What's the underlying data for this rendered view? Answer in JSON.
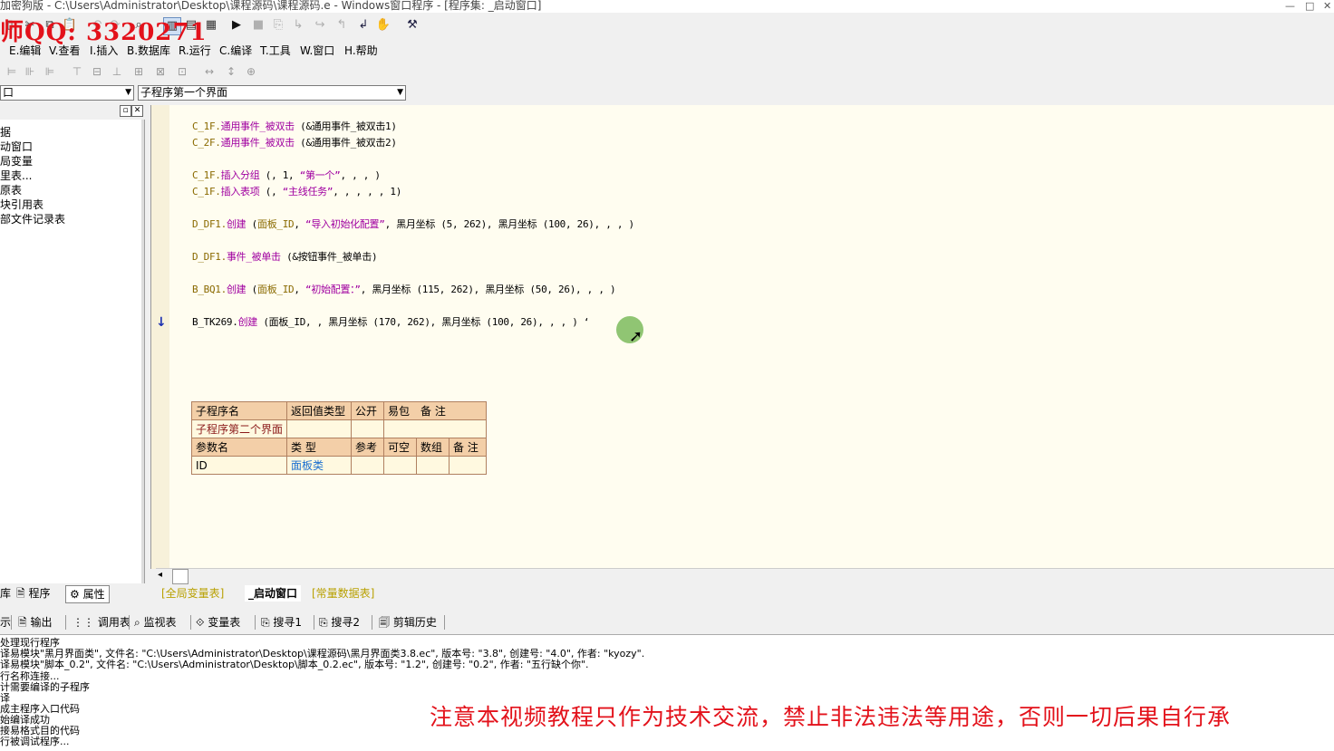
{
  "window": {
    "title": "加密狗版 - C:\\Users\\Administrator\\Desktop\\课程源码\\课程源码.e - Windows窗口程序 - [程序集: _启动窗口]"
  },
  "overlay": {
    "qq": "师QQ: 3320271",
    "warning": "注意本视频教程只作为技术交流，禁止非法违法等用途，否则一切后果自行承"
  },
  "menu": {
    "items": [
      "E.编辑",
      "V.查看",
      "I.插入",
      "B.数据库",
      "R.运行",
      "C.编译",
      "T.工具",
      "W.窗口",
      "H.帮助"
    ]
  },
  "combos": {
    "left_value": "口",
    "right_value": "子程序第一个界面"
  },
  "tree": {
    "items": [
      "据",
      "动窗口",
      "局变量",
      "里表...",
      "原表",
      "块引用表",
      "部文件记录表"
    ]
  },
  "left_tabs": [
    "库",
    "程序",
    "属性"
  ],
  "editor": {
    "lines": [
      [
        [
          "C_1F.",
          "obj"
        ],
        [
          "通用事件_被双击",
          "met"
        ],
        [
          " (&通用事件_被双击1)",
          "blk"
        ]
      ],
      [
        [
          "C_2F.",
          "obj"
        ],
        [
          "通用事件_被双击",
          "met"
        ],
        [
          " (&通用事件_被双击2)",
          "blk"
        ]
      ],
      [],
      [
        [
          "C_1F.",
          "obj"
        ],
        [
          "插入分组",
          "met"
        ],
        [
          " (, 1, ",
          "blk"
        ],
        [
          "“第一个”",
          "str"
        ],
        [
          ", , , )",
          "blk"
        ]
      ],
      [
        [
          "C_1F.",
          "obj"
        ],
        [
          "插入表项",
          "met"
        ],
        [
          " (, ",
          "blk"
        ],
        [
          "“主线任务”",
          "str"
        ],
        [
          ", , , , , 1)",
          "blk"
        ]
      ],
      [],
      [
        [
          "D_DF1.",
          "obj"
        ],
        [
          "创建",
          "met"
        ],
        [
          " (",
          "blk"
        ],
        [
          "面板_ID",
          "arg"
        ],
        [
          ", ",
          "blk"
        ],
        [
          "“导入初始化配置”",
          "str"
        ],
        [
          ", 黑月坐标 (5, 262), 黑月坐标 (100, 26), , , )",
          "blk"
        ]
      ],
      [],
      [
        [
          "D_DF1.",
          "obj"
        ],
        [
          "事件_被单击",
          "met"
        ],
        [
          " (&按钮事件_被单击)",
          "blk"
        ]
      ],
      [],
      [
        [
          "B_BQ1.",
          "obj"
        ],
        [
          "创建",
          "met"
        ],
        [
          " (",
          "blk"
        ],
        [
          "面板_ID",
          "arg"
        ],
        [
          ", ",
          "blk"
        ],
        [
          "“初始配置：”",
          "str"
        ],
        [
          ", 黑月坐标 (115, 262), 黑月坐标 (50, 26), , , )",
          "blk"
        ]
      ],
      [],
      [
        [
          "B_TK269.",
          "blk"
        ],
        [
          "创建",
          "met"
        ],
        [
          " (面板_ID, , 黑月坐标 (170, 262), 黑月坐标 (100, 26), , , ) ‘",
          "blk"
        ]
      ]
    ]
  },
  "subtable": {
    "header1": [
      "子程序名",
      "返回值类型",
      "公开",
      "易包",
      "备 注"
    ],
    "row1": [
      "子程序第二个界面",
      "",
      "",
      "",
      ""
    ],
    "header2": [
      "参数名",
      "类 型",
      "参考",
      "可空",
      "数组",
      "备 注"
    ],
    "row2": [
      "ID",
      "面板类",
      "",
      "",
      "",
      ""
    ]
  },
  "editor_tabs": [
    "[全局变量表]",
    "_启动窗口",
    "[常量数据表]"
  ],
  "output_tabs": [
    "示",
    "输出",
    "调用表",
    "监视表",
    "变量表",
    "搜寻1",
    "搜寻2",
    "剪辑历史"
  ],
  "output": {
    "lines": [
      "处理现行程序",
      "译易模块\"黑月界面类\", 文件名: \"C:\\Users\\Administrator\\Desktop\\课程源码\\黑月界面类3.8.ec\", 版本号: \"3.8\", 创建号: \"4.0\", 作者: \"kyozy\".",
      "译易模块\"脚本_0.2\", 文件名: \"C:\\Users\\Administrator\\Desktop\\脚本_0.2.ec\", 版本号: \"1.2\", 创建号: \"0.2\", 作者: \"五行缺个你\".",
      "行名称连接...",
      "计需要编译的子程序",
      "译",
      "成主程序入口代码",
      "始编译成功",
      "接易格式目的代码",
      "行被调试程序..."
    ]
  },
  "colors": {
    "editor_bg": "#fffdf0",
    "overlay_red": "#e3121b",
    "table_header": "#f3cfa8"
  }
}
